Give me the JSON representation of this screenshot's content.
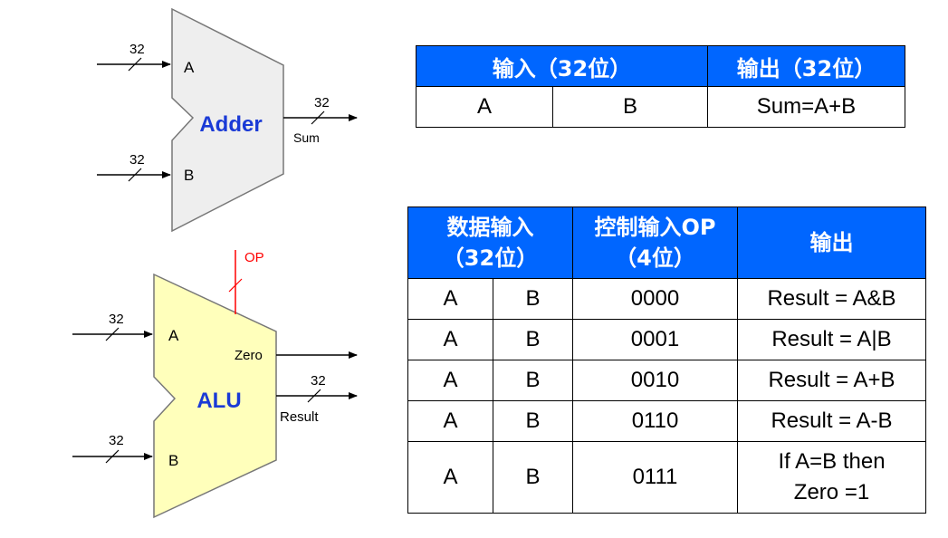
{
  "adder": {
    "name": "Adder",
    "input_a": "A",
    "input_b": "B",
    "width_a": "32",
    "width_b": "32",
    "width_sum": "32",
    "output_sum": "Sum"
  },
  "alu": {
    "name": "ALU",
    "input_a": "A",
    "input_b": "B",
    "width_a": "32",
    "width_b": "32",
    "op_label": "OP",
    "output_zero": "Zero",
    "output_result": "Result",
    "width_result": "32"
  },
  "adder_table": {
    "header_input": "输入（32位）",
    "header_output": "输出（32位）",
    "row": [
      "A",
      "B",
      "Sum=A+B"
    ]
  },
  "alu_table": {
    "header_data_input": "数据输入\n（32位）",
    "header_control_input": "控制输入OP\n（4位）",
    "header_output": "输出",
    "rows": [
      [
        "A",
        "B",
        "0000",
        "Result = A&B"
      ],
      [
        "A",
        "B",
        "0001",
        "Result = A|B"
      ],
      [
        "A",
        "B",
        "0010",
        "Result = A+B"
      ],
      [
        "A",
        "B",
        "0110",
        "Result = A-B"
      ],
      [
        "A",
        "B",
        "0111",
        "If A=B then\nZero =1"
      ]
    ]
  },
  "colors": {
    "header_bg": "#0066ff",
    "header_text": "#ffffff",
    "adder_fill": "#eeeeee",
    "alu_fill": "#ffffbb",
    "unit_name": "#1a3ad6",
    "op_color": "#ff0000"
  }
}
